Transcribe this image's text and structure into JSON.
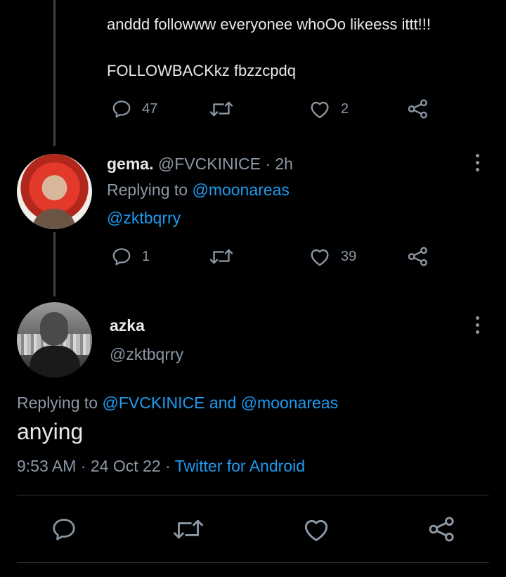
{
  "tweet1": {
    "line1": "anddd followww everyonee whoOo likeess ittt!!!",
    "line2": "FOLLOWBACKkz fbzzcpdq",
    "reply_count": "47",
    "like_count": "2"
  },
  "reply1": {
    "name": "gema.",
    "handle": "@FVCKINICE",
    "sep": "·",
    "time": "2h",
    "replying_label": "Replying to",
    "replying_to_1": "@moonareas",
    "replying_to_2": "@zktbqrry",
    "reply_count": "1",
    "like_count": "39"
  },
  "main_tweet": {
    "name": "azka",
    "handle": "@zktbqrry",
    "replying_label": "Replying to",
    "replying_to_1": "@FVCKINICE",
    "and_text": "and",
    "replying_to_2": "@moonareas",
    "text": "anying",
    "time": "9:53 AM",
    "sep1": "·",
    "date": "24 Oct 22",
    "sep2": "·",
    "source": "Twitter for Android"
  },
  "icons": [
    "reply-icon",
    "retweet-icon",
    "like-icon",
    "share-icon",
    "more-icon"
  ],
  "colors": {
    "background": "#000000",
    "text": "#e7e9ea",
    "muted": "#8b98a5",
    "link": "#1d9bf0",
    "thread_line": "#3e4144"
  }
}
